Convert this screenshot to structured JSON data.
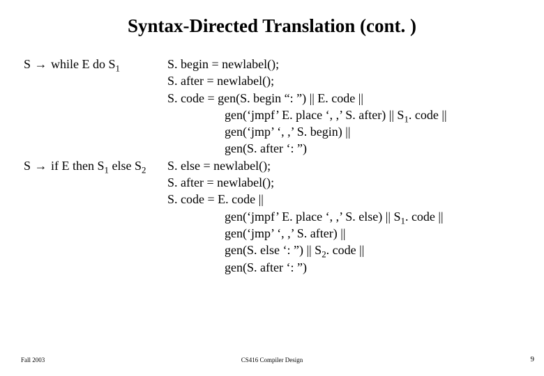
{
  "title": "Syntax-Directed Translation (cont. )",
  "rules": {
    "while": {
      "lhs_pre": "S ",
      "lhs_mid": "→",
      "lhs_post": " while E do S",
      "lhs_sub": "1",
      "lines": [
        {
          "text": "S. begin = newlabel();",
          "indent": false
        },
        {
          "text": "S. after = newlabel();",
          "indent": false
        },
        {
          "text": "S. code = gen(S. begin “: ”)  ||  E. code  ||",
          "indent": false
        },
        {
          "pre": "gen(‘jmpf’ E. place ‘, ,’ S. after)  || S",
          "sub": "1",
          "post": ". code ||",
          "indent": true
        },
        {
          "text": "gen(‘jmp’ ‘, ,’ S. begin)  ||",
          "indent": true
        },
        {
          "text": "gen(S. after ‘: ”)",
          "indent": true
        }
      ]
    },
    "ifelse": {
      "lhs_pre": "S ",
      "lhs_mid": "→",
      "lhs_post": " if E then S",
      "lhs_sub": "1",
      "lhs_tail": " else S",
      "lhs_sub2": "2",
      "lines": [
        {
          "text": "S. else = newlabel();",
          "indent": false
        },
        {
          "text": "S. after = newlabel();",
          "indent": false
        },
        {
          "text": "S. code = E. code  ||",
          "indent": false
        },
        {
          "pre": "gen(‘jmpf’ E. place ‘, ,’ S. else)  || S",
          "sub": "1",
          "post": ". code ||",
          "indent": true
        },
        {
          "text": "gen(‘jmp’ ‘, ,’ S. after)  ||",
          "indent": true
        },
        {
          "pre": "gen(S. else ‘: ”) || S",
          "sub": "2",
          "post": ". code ||",
          "indent": true
        },
        {
          "text": "gen(S. after ‘: ”)",
          "indent": true
        }
      ]
    }
  },
  "footer": {
    "left": "Fall 2003",
    "center": "CS416 Compiler Design",
    "right": "9"
  }
}
